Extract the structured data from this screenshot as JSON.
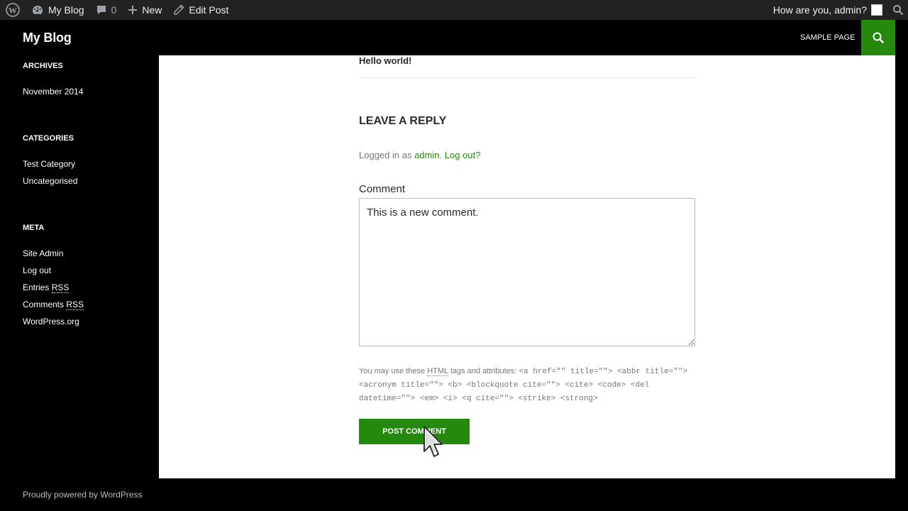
{
  "adminbar": {
    "site_name": "My Blog",
    "comments_count": "0",
    "new_label": "New",
    "edit_label": "Edit Post",
    "greeting": "How are you, admin?"
  },
  "header": {
    "site_title": "My Blog",
    "nav_sample": "SAMPLE PAGE"
  },
  "sidebar": {
    "archives": {
      "title": "ARCHIVES",
      "items": [
        "November 2014"
      ]
    },
    "categories": {
      "title": "CATEGORIES",
      "items": [
        "Test Category",
        "Uncategorised"
      ]
    },
    "meta": {
      "title": "META",
      "site_admin": "Site Admin",
      "log_out": "Log out",
      "entries": "Entries",
      "comments": "Comments",
      "rss": "RSS",
      "wordpress": "WordPress.org"
    }
  },
  "content": {
    "post_title": "Hello world!",
    "reply_title": "LEAVE A REPLY",
    "logged_in_prefix": "Logged in as",
    "logged_in_user": "admin",
    "logged_in_sep": ".",
    "logout_link": "Log out?",
    "comment_label": "Comment",
    "comment_value": "This is a new comment.",
    "allowed_prefix": "You may use these",
    "allowed_abbr": "HTML",
    "allowed_suffix": "tags and attributes:",
    "allowed_code": "<a href=\"\" title=\"\"> <abbr title=\"\"> <acronym title=\"\"> <b> <blockquote cite=\"\"> <cite> <code> <del datetime=\"\"> <em> <i> <q cite=\"\"> <strike> <strong>",
    "submit_label": "POST COMMENT"
  },
  "footer": {
    "credit": "Proudly powered by WordPress"
  },
  "colors": {
    "accent": "#24890d",
    "adminbar_bg": "#222222",
    "background": "#000000"
  }
}
